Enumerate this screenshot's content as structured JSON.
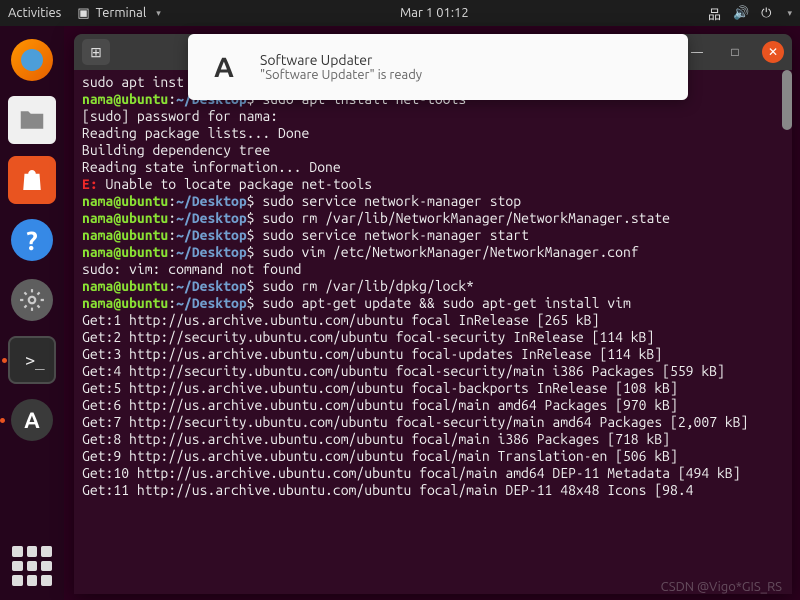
{
  "topbar": {
    "activities": "Activities",
    "app": "Terminal",
    "date": "Mar 1  01:12"
  },
  "notif": {
    "title": "Software Updater",
    "body": "\"Software Updater\" is ready"
  },
  "window": {
    "minimize": "—",
    "maximize": "□",
    "close": "✕"
  },
  "term": {
    "l0": "sudo apt inst",
    "u": "nama@ubuntu",
    "p": "~/Desktop",
    "d": "$",
    "c1": "sudo apt install net-tools",
    "l1": "[sudo] password for nama:",
    "l2": "Reading package lists... Done",
    "l3": "Building dependency tree",
    "l4": "Reading state information... Done",
    "err": "E:",
    "errtxt": " Unable to locate package net-tools",
    "c2": "sudo service network-manager stop",
    "c3": "sudo rm /var/lib/NetworkManager/NetworkManager.state",
    "c4": "sudo service network-manager start",
    "c5": "sudo vim /etc/NetworkManager/NetworkManager.conf",
    "l5": "sudo: vim: command not found",
    "c6": "sudo rm /var/lib/dpkg/lock*",
    "c7": "sudo apt-get update && sudo apt-get install vim",
    "g1": "Get:1 http://us.archive.ubuntu.com/ubuntu focal InRelease [265 kB]",
    "g2": "Get:2 http://security.ubuntu.com/ubuntu focal-security InRelease [114 kB]",
    "g3": "Get:3 http://us.archive.ubuntu.com/ubuntu focal-updates InRelease [114 kB]",
    "g4": "Get:4 http://security.ubuntu.com/ubuntu focal-security/main i386 Packages [559 kB]",
    "g5": "Get:5 http://us.archive.ubuntu.com/ubuntu focal-backports InRelease [108 kB]",
    "g6": "Get:6 http://us.archive.ubuntu.com/ubuntu focal/main amd64 Packages [970 kB]",
    "g7": "Get:7 http://security.ubuntu.com/ubuntu focal-security/main amd64 Packages [2,007 kB]",
    "g8": "Get:8 http://us.archive.ubuntu.com/ubuntu focal/main i386 Packages [718 kB]",
    "g9": "Get:9 http://us.archive.ubuntu.com/ubuntu focal/main Translation-en [506 kB]",
    "g10": "Get:10 http://us.archive.ubuntu.com/ubuntu focal/main amd64 DEP-11 Metadata [494 kB]",
    "g11": "Get:11 http://us.archive.ubuntu.com/ubuntu focal/main DEP-11 48x48 Icons [98.4"
  },
  "watermark": "CSDN @Vigo*GIS_RS"
}
